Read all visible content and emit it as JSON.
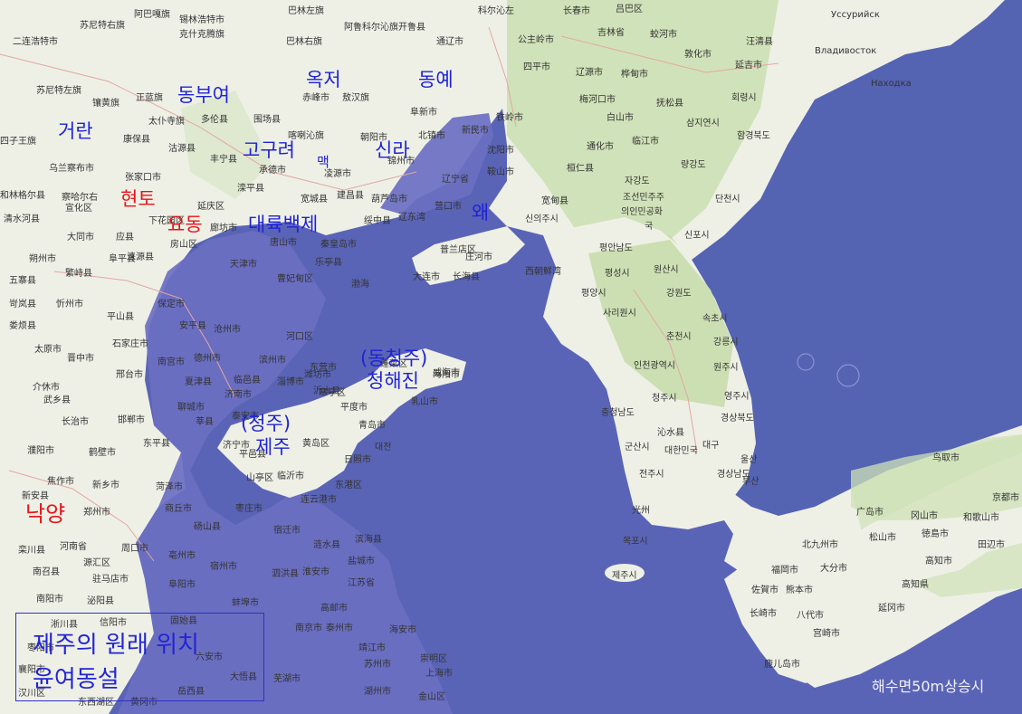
{
  "map": {
    "colors": {
      "land": "#eef0e6",
      "sea": "#5563b3",
      "flooded": "#6b6fc2",
      "forest": "#b9d69e",
      "region_label": "#1f22d8",
      "highlight_label": "#e8131a"
    },
    "region_labels": [
      {
        "id": "dongbuyeo",
        "text": "동부여"
      },
      {
        "id": "okjeo",
        "text": "옥저"
      },
      {
        "id": "dongye",
        "text": "동예"
      },
      {
        "id": "georan",
        "text": "거란"
      },
      {
        "id": "goguryeo",
        "text": "고구려"
      },
      {
        "id": "maek",
        "text": "맥"
      },
      {
        "id": "silla",
        "text": "신라"
      },
      {
        "id": "hyeonto",
        "text": "현토"
      },
      {
        "id": "yodong",
        "text": "요동"
      },
      {
        "id": "daeryukbaekje",
        "text": "대륙백제"
      },
      {
        "id": "wae",
        "text": "왜"
      },
      {
        "id": "dongcheongju",
        "text": "(동청주)"
      },
      {
        "id": "cheonghaejin",
        "text": "청해진"
      },
      {
        "id": "cheongju",
        "text": "(청주)"
      },
      {
        "id": "jeju",
        "text": "제주"
      },
      {
        "id": "nakyang",
        "text": "낙양"
      }
    ],
    "place_labels": [
      {
        "text": "阿巴嘎旗"
      },
      {
        "text": "锡林浩特市"
      },
      {
        "text": "巴林左旗"
      },
      {
        "text": "科尔沁左"
      },
      {
        "text": "长春市"
      },
      {
        "text": "吕巴区"
      },
      {
        "text": "苏尼特右旗"
      },
      {
        "text": "克什克腾旗"
      },
      {
        "text": "巴林右旗"
      },
      {
        "text": "阿鲁科尔沁旗"
      },
      {
        "text": "开鲁县"
      },
      {
        "text": "通辽市"
      },
      {
        "text": "公主岭市"
      },
      {
        "text": "吉林省"
      },
      {
        "text": "蛟河市"
      },
      {
        "text": "Уссурийск"
      },
      {
        "text": "汪清县"
      },
      {
        "text": "Владивосток"
      },
      {
        "text": "二连浩特市"
      },
      {
        "text": "正蓝旗"
      },
      {
        "text": "多伦县"
      },
      {
        "text": "赤峰市"
      },
      {
        "text": "敖汉旗"
      },
      {
        "text": "阜新市"
      },
      {
        "text": "四平市"
      },
      {
        "text": "辽源市"
      },
      {
        "text": "敦化市"
      },
      {
        "text": "延吉市"
      },
      {
        "text": "Находка"
      },
      {
        "text": "苏尼特左旗"
      },
      {
        "text": "镶黄旗"
      },
      {
        "text": "太仆寺旗"
      },
      {
        "text": "围场县"
      },
      {
        "text": "铁岭市"
      },
      {
        "text": "梅河口市"
      },
      {
        "text": "白山市"
      },
      {
        "text": "抚松县"
      },
      {
        "text": "桦甸市"
      },
      {
        "text": "회령시"
      },
      {
        "text": "四子王旗"
      },
      {
        "text": "康保县"
      },
      {
        "text": "沽源县"
      },
      {
        "text": "丰宁县"
      },
      {
        "text": "喀喇沁旗"
      },
      {
        "text": "朝阳市"
      },
      {
        "text": "北镇市"
      },
      {
        "text": "新民市"
      },
      {
        "text": "沈阳市"
      },
      {
        "text": "通化市"
      },
      {
        "text": "临江市"
      },
      {
        "text": "삼지연시"
      },
      {
        "text": "함경북도"
      },
      {
        "text": "乌兰察布市"
      },
      {
        "text": "张家口市"
      },
      {
        "text": "承德市"
      },
      {
        "text": "凌源市"
      },
      {
        "text": "锦州市"
      },
      {
        "text": "辽宁省"
      },
      {
        "text": "鞍山市"
      },
      {
        "text": "桓仁县"
      },
      {
        "text": "자강도"
      },
      {
        "text": "량강도"
      },
      {
        "text": "和林格尔县"
      },
      {
        "text": "察哈尔右"
      },
      {
        "text": "宣化区"
      },
      {
        "text": "延庆区"
      },
      {
        "text": "滦平县"
      },
      {
        "text": "宽城县"
      },
      {
        "text": "建昌县"
      },
      {
        "text": "葫芦岛市"
      },
      {
        "text": "营口市"
      },
      {
        "text": "宽甸县"
      },
      {
        "text": "조선민주주"
      },
      {
        "text": "의인민공화"
      },
      {
        "text": "국"
      },
      {
        "text": "단천시"
      },
      {
        "text": "清水河县"
      },
      {
        "text": "大同市"
      },
      {
        "text": "下花园区"
      },
      {
        "text": "廊坊市"
      },
      {
        "text": "唐山市"
      },
      {
        "text": "秦皇岛市"
      },
      {
        "text": "绥中县"
      },
      {
        "text": "辽东湾"
      },
      {
        "text": "普兰店区"
      },
      {
        "text": "庄河市"
      },
      {
        "text": "신의주시"
      },
      {
        "text": "신포시"
      },
      {
        "text": "朔州市"
      },
      {
        "text": "应县"
      },
      {
        "text": "涞源县"
      },
      {
        "text": "房山区"
      },
      {
        "text": "天津市"
      },
      {
        "text": "乐亭县"
      },
      {
        "text": "大连市"
      },
      {
        "text": "长海县"
      },
      {
        "text": "평안남도"
      },
      {
        "text": "평성시"
      },
      {
        "text": "원산시"
      },
      {
        "text": "五寨县"
      },
      {
        "text": "繁峙县"
      },
      {
        "text": "阜平县"
      },
      {
        "text": "保定市"
      },
      {
        "text": "曹妃甸区"
      },
      {
        "text": "渤海"
      },
      {
        "text": "西朝鮮湾"
      },
      {
        "text": "평양시"
      },
      {
        "text": "강원도"
      },
      {
        "text": "岢岚县"
      },
      {
        "text": "忻州市"
      },
      {
        "text": "平山县"
      },
      {
        "text": "安平县"
      },
      {
        "text": "沧州市"
      },
      {
        "text": "河口区"
      },
      {
        "text": "사리원시"
      },
      {
        "text": "속초시"
      },
      {
        "text": "娄烦县"
      },
      {
        "text": "石家庄市"
      },
      {
        "text": "滨州市"
      },
      {
        "text": "东营市"
      },
      {
        "text": "蓬莱区"
      },
      {
        "text": "威海市"
      },
      {
        "text": "강릉시"
      },
      {
        "text": "춘천시"
      },
      {
        "text": "太原市"
      },
      {
        "text": "晋中市"
      },
      {
        "text": "南宫市"
      },
      {
        "text": "德州市"
      },
      {
        "text": "临邑县"
      },
      {
        "text": "潍坊市"
      },
      {
        "text": "海阳市"
      },
      {
        "text": "인천광역시"
      },
      {
        "text": "원주시"
      },
      {
        "text": "영주시"
      },
      {
        "text": "介休市"
      },
      {
        "text": "邢台市"
      },
      {
        "text": "夏津县"
      },
      {
        "text": "济南市"
      },
      {
        "text": "淄博市"
      },
      {
        "text": "寒亭区"
      },
      {
        "text": "乳山市"
      },
      {
        "text": "청주시"
      },
      {
        "text": "武乡县"
      },
      {
        "text": "聊城市"
      },
      {
        "text": "泰安市"
      },
      {
        "text": "沂水县"
      },
      {
        "text": "平度市"
      },
      {
        "text": "青岛市"
      },
      {
        "text": "충청남도"
      },
      {
        "text": "경상북도"
      },
      {
        "text": "长治市"
      },
      {
        "text": "邯郸市"
      },
      {
        "text": "莘县"
      },
      {
        "text": "黄岛区"
      },
      {
        "text": "대전"
      },
      {
        "text": "沁水县"
      },
      {
        "text": "濮阳市"
      },
      {
        "text": "东平县"
      },
      {
        "text": "济宁市"
      },
      {
        "text": "日照市"
      },
      {
        "text": "대구"
      },
      {
        "text": "鹤壁市"
      },
      {
        "text": "平邑县"
      },
      {
        "text": "临沂市"
      },
      {
        "text": "군산시"
      },
      {
        "text": "대한민국"
      },
      {
        "text": "울산"
      },
      {
        "text": "焦作市"
      },
      {
        "text": "新乡市"
      },
      {
        "text": "菏泽市"
      },
      {
        "text": "山亭区"
      },
      {
        "text": "东港区"
      },
      {
        "text": "전주시"
      },
      {
        "text": "경상남도"
      },
      {
        "text": "부산"
      },
      {
        "text": "新安县"
      },
      {
        "text": "郑州市"
      },
      {
        "text": "商丘市"
      },
      {
        "text": "枣庄市"
      },
      {
        "text": "连云港市"
      },
      {
        "text": "鸟取市"
      },
      {
        "text": "京都市"
      },
      {
        "text": "广岛市"
      },
      {
        "text": "冈山市"
      },
      {
        "text": "和歌山市"
      },
      {
        "text": "河南省"
      },
      {
        "text": "砀山县"
      },
      {
        "text": "宿迁市"
      },
      {
        "text": "滨海县"
      },
      {
        "text": "光州"
      },
      {
        "text": "목포시"
      },
      {
        "text": "松山市"
      },
      {
        "text": "徳島市"
      },
      {
        "text": "栾川县"
      },
      {
        "text": "周口市"
      },
      {
        "text": "亳州市"
      },
      {
        "text": "宿州市"
      },
      {
        "text": "涟水县"
      },
      {
        "text": "北九州市"
      },
      {
        "text": "大分市"
      },
      {
        "text": "田辺市"
      },
      {
        "text": "南召县"
      },
      {
        "text": "源汇区"
      },
      {
        "text": "泗洪县"
      },
      {
        "text": "淮安市"
      },
      {
        "text": "盐城市"
      },
      {
        "text": "제주시"
      },
      {
        "text": "福岡市"
      },
      {
        "text": "佐賀市"
      },
      {
        "text": "高知市"
      },
      {
        "text": "驻马店市"
      },
      {
        "text": "阜阳市"
      },
      {
        "text": "江苏省"
      },
      {
        "text": "熊本市"
      },
      {
        "text": "高知県"
      },
      {
        "text": "南阳市"
      },
      {
        "text": "泌阳县"
      },
      {
        "text": "蚌埠市"
      },
      {
        "text": "高邮市"
      },
      {
        "text": "长崎市"
      },
      {
        "text": "八代市"
      },
      {
        "text": "延冈市"
      },
      {
        "text": "淅川县"
      },
      {
        "text": "信阳市"
      },
      {
        "text": "固始县"
      },
      {
        "text": "泰州市"
      },
      {
        "text": "海安市"
      },
      {
        "text": "宫崎市"
      },
      {
        "text": "枣阳市"
      },
      {
        "text": "南京市"
      },
      {
        "text": "鹿儿岛市"
      },
      {
        "text": "襄阳市"
      },
      {
        "text": "六安市"
      },
      {
        "text": "靖江市"
      },
      {
        "text": "苏州市"
      },
      {
        "text": "崇明区"
      },
      {
        "text": "上海市"
      },
      {
        "text": "大悟县"
      },
      {
        "text": "芜湖市"
      },
      {
        "text": "湖州市"
      },
      {
        "text": "金山区"
      },
      {
        "text": "东西湖区"
      },
      {
        "text": "黄冈市"
      },
      {
        "text": "岳西县"
      },
      {
        "text": "汉川区"
      }
    ],
    "legend": {
      "line1": "제주의 원래 위치",
      "line2": "윤여동설"
    },
    "sea_level_note": "해수면50m상승시"
  }
}
